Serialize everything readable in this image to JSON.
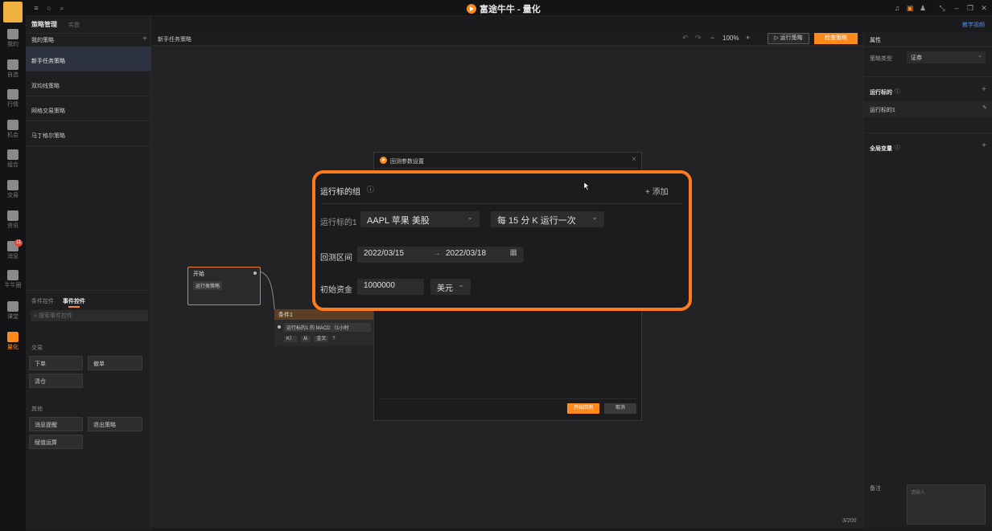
{
  "app": {
    "title": "富途牛牛 - 量化",
    "help": "教学视频"
  },
  "rail": [
    {
      "label": "我的",
      "icon": "user-icon"
    },
    {
      "label": "自选",
      "icon": "watchlist-icon"
    },
    {
      "label": "行情",
      "icon": "market-icon"
    },
    {
      "label": "机会",
      "icon": "funnel-icon"
    },
    {
      "label": "组合",
      "icon": "pie-icon"
    },
    {
      "label": "交易",
      "icon": "trade-icon"
    },
    {
      "label": "资讯",
      "icon": "news-icon"
    },
    {
      "label": "消息",
      "icon": "message-icon",
      "badge": "11"
    },
    {
      "label": "牛牛圈",
      "icon": "community-icon"
    },
    {
      "label": "课堂",
      "icon": "classroom-icon"
    },
    {
      "label": "量化",
      "icon": "quant-icon"
    }
  ],
  "strategy_panel": {
    "tab_active": "策略管理",
    "tab_other": "实盘",
    "my_strategies": "我的策略",
    "items": [
      "新手任务策略",
      "双均线策略",
      "网格交易策略",
      "马丁格尔策略"
    ]
  },
  "controls": {
    "tab_condition": "条件控件",
    "tab_event": "事件控件",
    "search_placeholder": "搜索事件控件",
    "group_trade": "交易",
    "trade_items": [
      "下单",
      "撤单",
      "清仓"
    ],
    "group_other": "其他",
    "other_items": [
      "消息提醒",
      "退出策略",
      "赋值运算"
    ]
  },
  "canvas": {
    "title": "新手任务策略",
    "zoom": "100%",
    "run": "运行策略",
    "check": "检查策略",
    "page_count": "3/200"
  },
  "nodes": {
    "start_title": "开始",
    "start_body": "运行类策略",
    "cond_title": "条件1",
    "cond_row1": "运行标的1 的 MACD （1小时",
    "cond_row2": [
      "K）",
      "从",
      "金叉"
    ],
    "cond_q": "?"
  },
  "dialog": {
    "title": "回测参数设置",
    "start_btn": "开始回测",
    "cancel_btn": "取消"
  },
  "zoom": {
    "group_title": "运行标的组",
    "add": "添加",
    "target_label": "运行标的1",
    "stock": "AAPL  苹果  美股",
    "freq": "每 15 分 K 运行一次",
    "range_label": "回测区间",
    "date_start": "2022/03/15",
    "date_end": "2022/03/18",
    "capital_label": "初始资金",
    "capital_value": "1000000",
    "currency": "美元"
  },
  "right_panel": {
    "attr": "属性",
    "stype_label": "策略类型",
    "stype_value": "证券",
    "targets_head": "运行标的",
    "target_item": "运行标的1",
    "globals_head": "全局变量",
    "note_label": "备注",
    "note_placeholder": "请输入"
  }
}
